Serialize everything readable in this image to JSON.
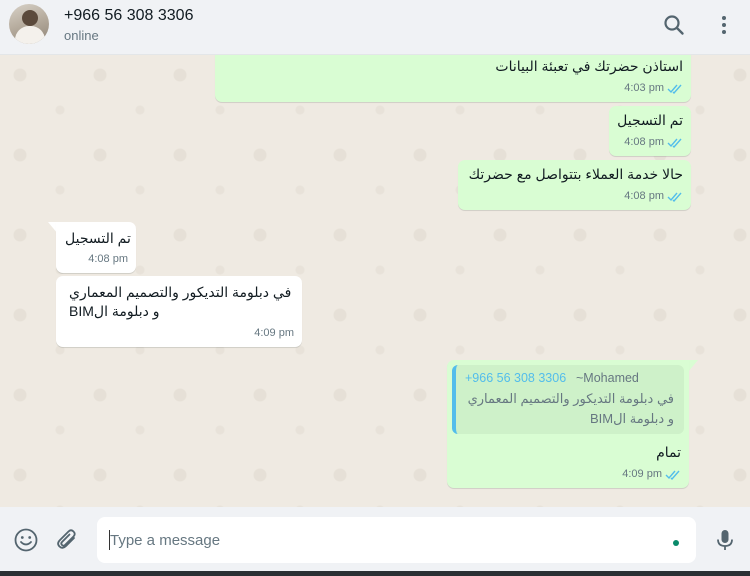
{
  "header": {
    "contact_name": "+966 56 308 3306",
    "status": "online",
    "icons": [
      "search-icon",
      "menu-icon"
    ]
  },
  "messages": [
    {
      "dir": "out",
      "text": "استاذن حضرتك في تعبئة البيانات",
      "time": "4:03 pm",
      "read": true
    },
    {
      "dir": "out",
      "text": "تم التسجيل",
      "time": "4:08 pm",
      "read": true
    },
    {
      "dir": "out",
      "text": "حالا خدمة العملاء بتتواصل مع حضرتك",
      "time": "4:08 pm",
      "read": true
    },
    {
      "dir": "in",
      "text": "تم التسجيل",
      "time": "4:08 pm"
    },
    {
      "dir": "in",
      "lines": [
        "في دبلومة التديكور والتصميم المعماري",
        "و دبلومة الBIM"
      ],
      "time": "4:09 pm"
    },
    {
      "dir": "out",
      "quote": {
        "phone": "+966 56 308 3306",
        "author": "~Mohamed",
        "lines": [
          "في دبلومة التديكور والتصميم المعماري",
          "و دبلومة الBIM"
        ]
      },
      "text": "تمام",
      "time": "4:09 pm",
      "read": true
    }
  ],
  "composer": {
    "placeholder": "Type a message",
    "icons": [
      "emoji-icon",
      "attach-icon",
      "mic-icon"
    ]
  },
  "colors": {
    "outgoing_bubble": "#d9fdd3",
    "incoming_bubble": "#ffffff",
    "read_ticks": "#53bdeb",
    "chat_background": "#efeae2"
  }
}
